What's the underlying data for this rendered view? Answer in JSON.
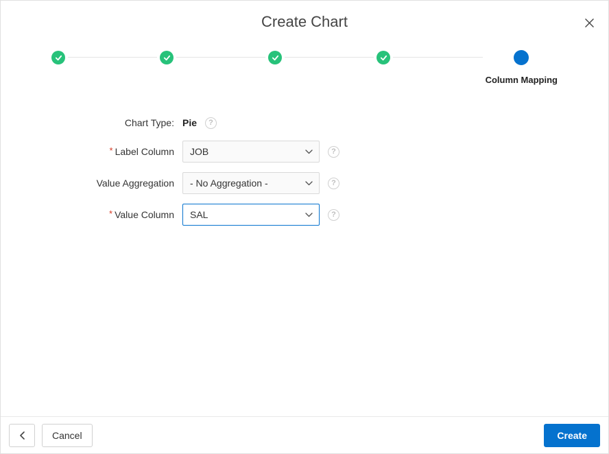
{
  "dialog": {
    "title": "Create Chart",
    "close": "✕"
  },
  "stepper": {
    "steps": [
      {
        "state": "complete",
        "label": ""
      },
      {
        "state": "complete",
        "label": ""
      },
      {
        "state": "complete",
        "label": ""
      },
      {
        "state": "complete",
        "label": ""
      },
      {
        "state": "current",
        "label": "Column Mapping"
      }
    ]
  },
  "form": {
    "chart_type_label": "Chart Type:",
    "chart_type_value": "Pie",
    "label_column": {
      "label": "Label Column",
      "value": "JOB",
      "required": true
    },
    "value_aggregation": {
      "label": "Value Aggregation",
      "value": "- No Aggregation -",
      "required": false
    },
    "value_column": {
      "label": "Value Column",
      "value": "SAL",
      "required": true
    },
    "required_marker": "*",
    "help_marker": "?"
  },
  "footer": {
    "back": "‹",
    "cancel": "Cancel",
    "create": "Create"
  }
}
